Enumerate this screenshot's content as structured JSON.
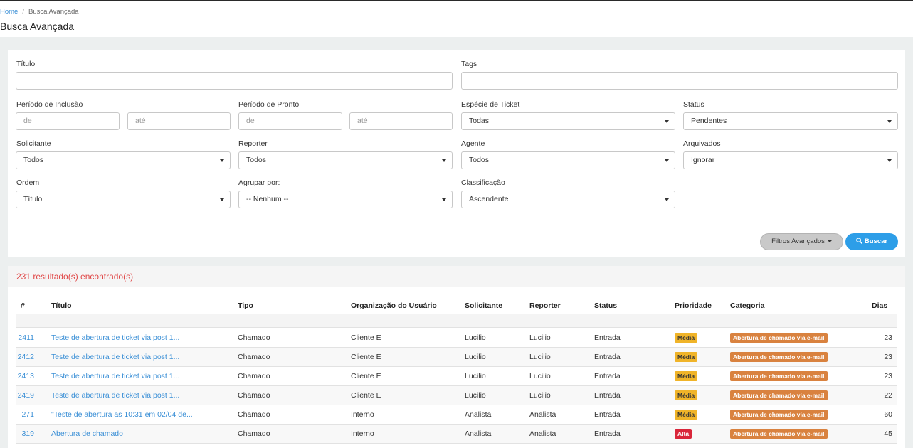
{
  "breadcrumb": {
    "home": "Home",
    "current": "Busca Avançada"
  },
  "page_title": "Busca Avançada",
  "form": {
    "titulo_label": "Título",
    "titulo_value": "",
    "tags_label": "Tags",
    "tags_value": "",
    "periodo_inclusao_label": "Período de Inclusão",
    "periodo_inclusao_de_placeholder": "de",
    "periodo_inclusao_ate_placeholder": "até",
    "periodo_pronto_label": "Período de Pronto",
    "periodo_pronto_de_placeholder": "de",
    "periodo_pronto_ate_placeholder": "até",
    "especie_label": "Espécie de Ticket",
    "especie_value": "Todas",
    "status_label": "Status",
    "status_value": "Pendentes",
    "solicitante_label": "Solicitante",
    "solicitante_value": "Todos",
    "reporter_label": "Reporter",
    "reporter_value": "Todos",
    "agente_label": "Agente",
    "agente_value": "Todos",
    "arquivados_label": "Arquivados",
    "arquivados_value": "Ignorar",
    "ordem_label": "Ordem",
    "ordem_value": "Título",
    "agrupar_label": "Agrupar por:",
    "agrupar_value": "-- Nenhum --",
    "classificacao_label": "Classificação",
    "classificacao_value": "Ascendente",
    "filtros_button": "Filtros Avançados",
    "buscar_button": "Buscar"
  },
  "results": {
    "count_text": "231 resultado(s) encontrado(s)",
    "columns": [
      "#",
      "Título",
      "Tipo",
      "Organização do Usuário",
      "Solicitante",
      "Reporter",
      "Status",
      "Prioridade",
      "Categoria",
      "Dias"
    ],
    "rows": [
      {
        "id": "2411",
        "titulo": "Teste de abertura de ticket via post 1...",
        "tipo": "Chamado",
        "org": "Cliente E",
        "solicitante": "Lucilio",
        "reporter": "Lucilio",
        "status": "Entrada",
        "prioridade": "Média",
        "categoria": "Abertura de chamado via e-mail",
        "dias": "23"
      },
      {
        "id": "2412",
        "titulo": "Teste de abertura de ticket via post 1...",
        "tipo": "Chamado",
        "org": "Cliente E",
        "solicitante": "Lucilio",
        "reporter": "Lucilio",
        "status": "Entrada",
        "prioridade": "Média",
        "categoria": "Abertura de chamado via e-mail",
        "dias": "23"
      },
      {
        "id": "2413",
        "titulo": "Teste de abertura de ticket via post 1...",
        "tipo": "Chamado",
        "org": "Cliente E",
        "solicitante": "Lucilio",
        "reporter": "Lucilio",
        "status": "Entrada",
        "prioridade": "Média",
        "categoria": "Abertura de chamado via e-mail",
        "dias": "23"
      },
      {
        "id": "2419",
        "titulo": "Teste de abertura de ticket via post 1...",
        "tipo": "Chamado",
        "org": "Cliente E",
        "solicitante": "Lucilio",
        "reporter": "Lucilio",
        "status": "Entrada",
        "prioridade": "Média",
        "categoria": "Abertura de chamado via e-mail",
        "dias": "22"
      },
      {
        "id": "271",
        "titulo": "\"Teste de abertura as 10:31 em 02/04 de...",
        "tipo": "Chamado",
        "org": "Interno",
        "solicitante": "Analista",
        "reporter": "Analista",
        "status": "Entrada",
        "prioridade": "Média",
        "categoria": "Abertura de chamado via e-mail",
        "dias": "60"
      },
      {
        "id": "319",
        "titulo": "Abertura de chamado",
        "tipo": "Chamado",
        "org": "Interno",
        "solicitante": "Analista",
        "reporter": "Analista",
        "status": "Entrada",
        "prioridade": "Alta",
        "categoria": "Abertura de chamado via e-mail",
        "dias": "45"
      }
    ]
  },
  "colors": {
    "link": "#3a8fd6",
    "primary_button": "#2d9ee8",
    "results_count": "#e04848",
    "priority_media": "#f0b429",
    "priority_alta": "#d9263a",
    "category_badge": "#d9823f"
  }
}
